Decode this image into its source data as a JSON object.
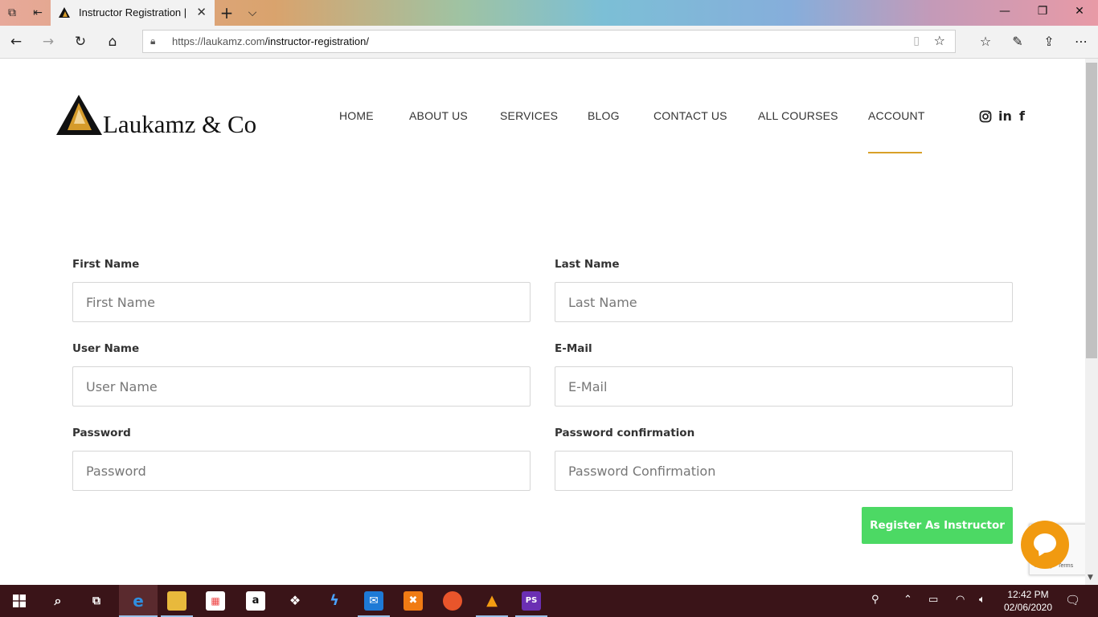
{
  "browser": {
    "tab_title": "Instructor Registration |",
    "url_host": "https://laukamz.com",
    "url_path": "/instructor-registration/"
  },
  "site": {
    "logo_text": "Laukamz & Co",
    "nav": [
      "HOME",
      "ABOUT US",
      "SERVICES",
      "BLOG",
      "CONTACT US",
      "ALL COURSES",
      "ACCOUNT"
    ],
    "active_nav": "ACCOUNT",
    "accent_color": "#d8a028"
  },
  "form": {
    "first_name_label": "First Name",
    "first_name_placeholder": "First Name",
    "last_name_label": "Last Name",
    "last_name_placeholder": "Last Name",
    "user_name_label": "User Name",
    "user_name_placeholder": "User Name",
    "email_label": "E-Mail",
    "email_placeholder": "E-Mail",
    "password_label": "Password",
    "password_placeholder": "Password",
    "password_confirm_label": "Password confirmation",
    "password_confirm_placeholder": "Password Confirmation",
    "submit_label": "Register As Instructor",
    "submit_color": "#4cd964"
  },
  "recaptcha": {
    "text": "Privacy - Terms"
  },
  "taskbar": {
    "time": "12:42 PM",
    "date": "02/06/2020"
  }
}
